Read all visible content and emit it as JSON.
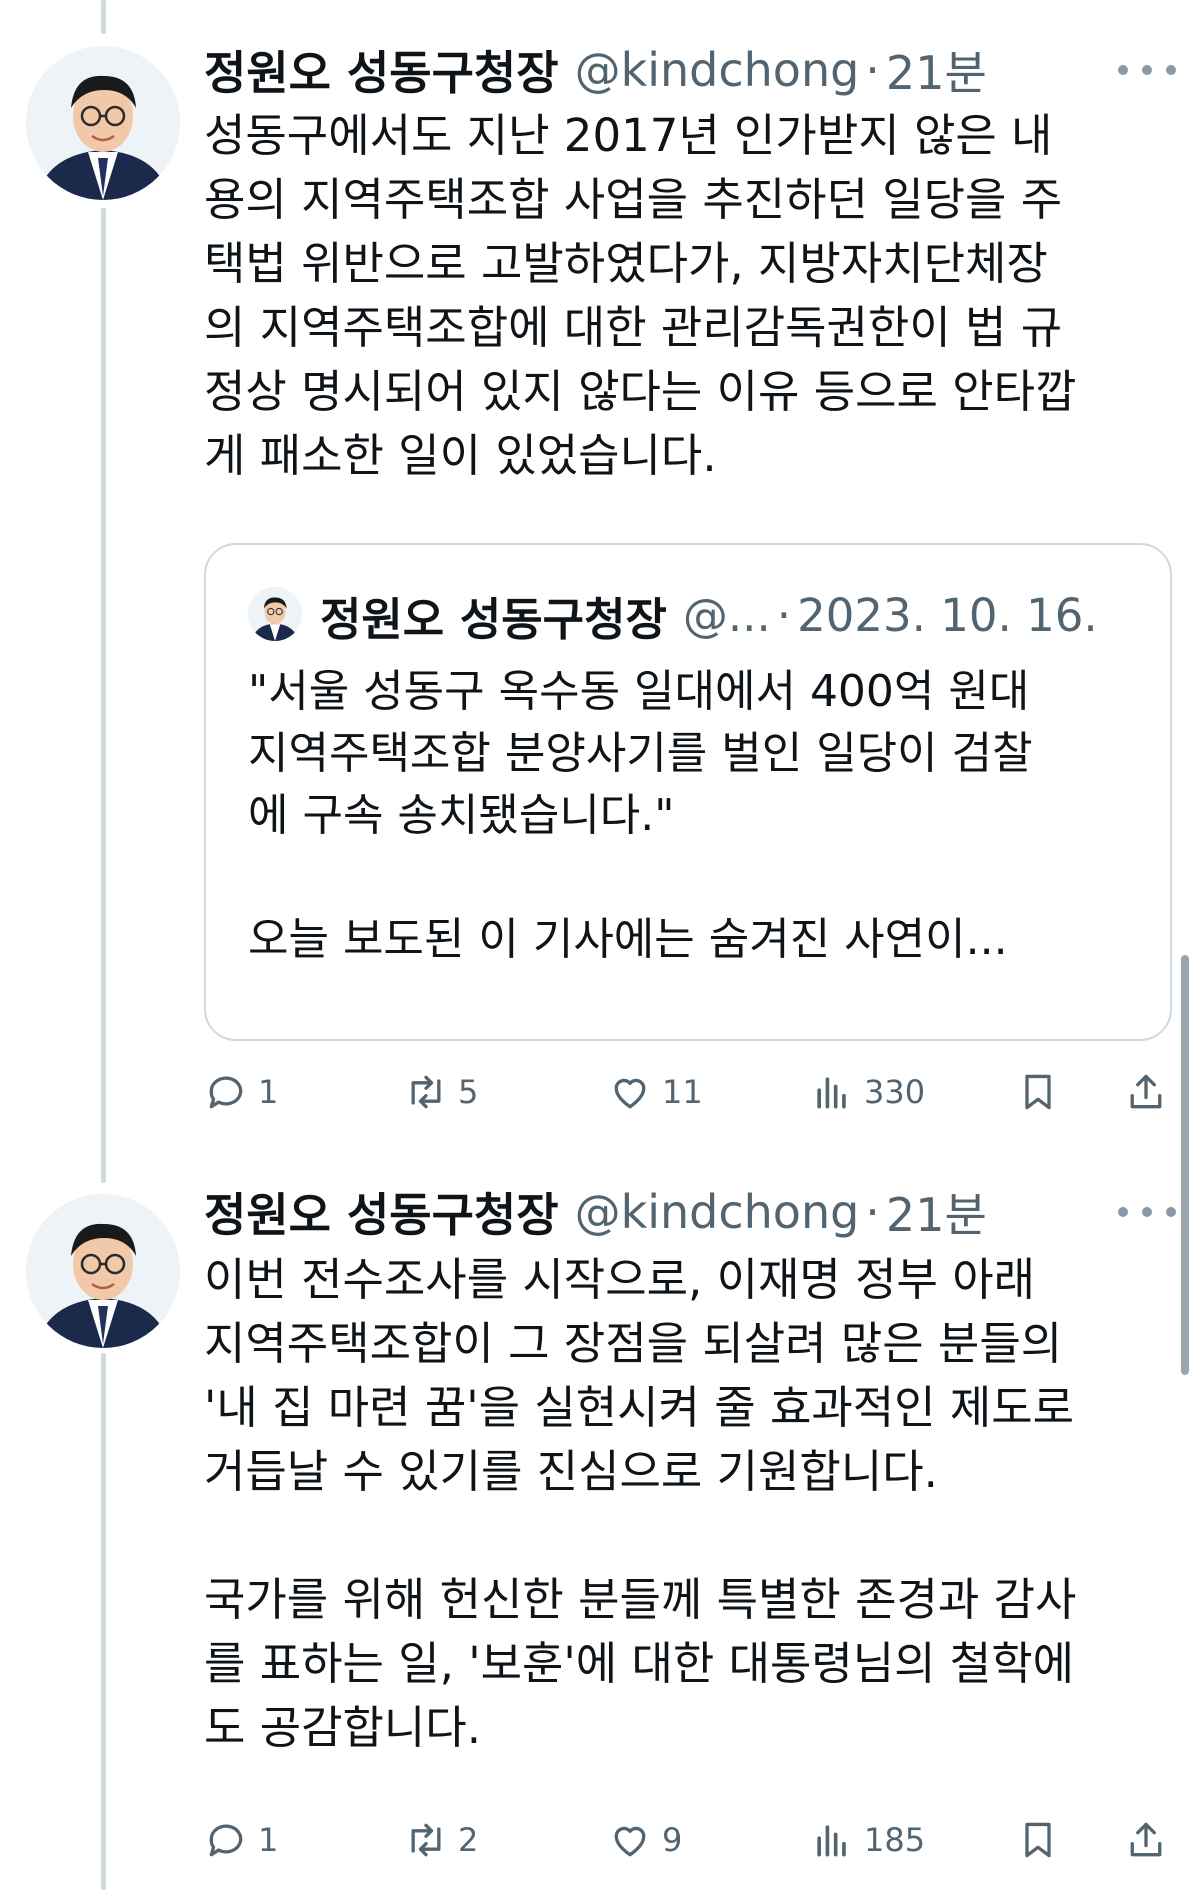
{
  "tweets": [
    {
      "name": "정원오 성동구청장",
      "handle": "@kindchong",
      "dot": "·",
      "time": "21분",
      "text": "성동구에서도 지난 2017년 인가받지 않은 내\n용의 지역주택조합 사업을 추진하던 일당을 주\n택법 위반으로 고발하였다가, 지방자치단체장\n의 지역주택조합에 대한 관리감독권한이 법 규\n정상 명시되어 있지 않다는 이유 등으로 안타깝\n게 패소한 일이 있었습니다.",
      "quote": {
        "name": "정원오 성동구청장",
        "handle": "@...",
        "dot": "·",
        "date": "2023. 10. 16.",
        "text": "\"서울 성동구 옥수동 일대에서 400억 원대\n지역주택조합 분양사기를 벌인 일당이 검찰\n에 구속 송치됐습니다.\"\n\n오늘 보도된 이 기사에는 숨겨진 사연이..."
      },
      "counts": {
        "reply": "1",
        "retweet": "5",
        "like": "11",
        "views": "330"
      }
    },
    {
      "name": "정원오 성동구청장",
      "handle": "@kindchong",
      "dot": "·",
      "time": "21분",
      "text": "이번 전수조사를 시작으로, 이재명 정부 아래\n지역주택조합이 그 장점을 되살려 많은 분들의\n'내 집 마련 꿈'을 실현시켜 줄 효과적인 제도로\n거듭날 수 있기를 진심으로 기원합니다.\n\n국가를 위해 헌신한 분들께 특별한 존경과 감사\n를 표하는 일, '보훈'에 대한 대통령님의 철학에\n도 공감합니다.",
      "counts": {
        "reply": "1",
        "retweet": "2",
        "like": "9",
        "views": "185"
      }
    }
  ],
  "icons": {
    "reply": "reply-icon",
    "retweet": "retweet-icon",
    "like": "heart-icon",
    "views": "views-icon",
    "bookmark": "bookmark-icon",
    "share": "share-icon",
    "more": "more-icon"
  },
  "colors": {
    "text": "#0f1419",
    "secondary": "#536471",
    "line": "#cfd9de"
  }
}
